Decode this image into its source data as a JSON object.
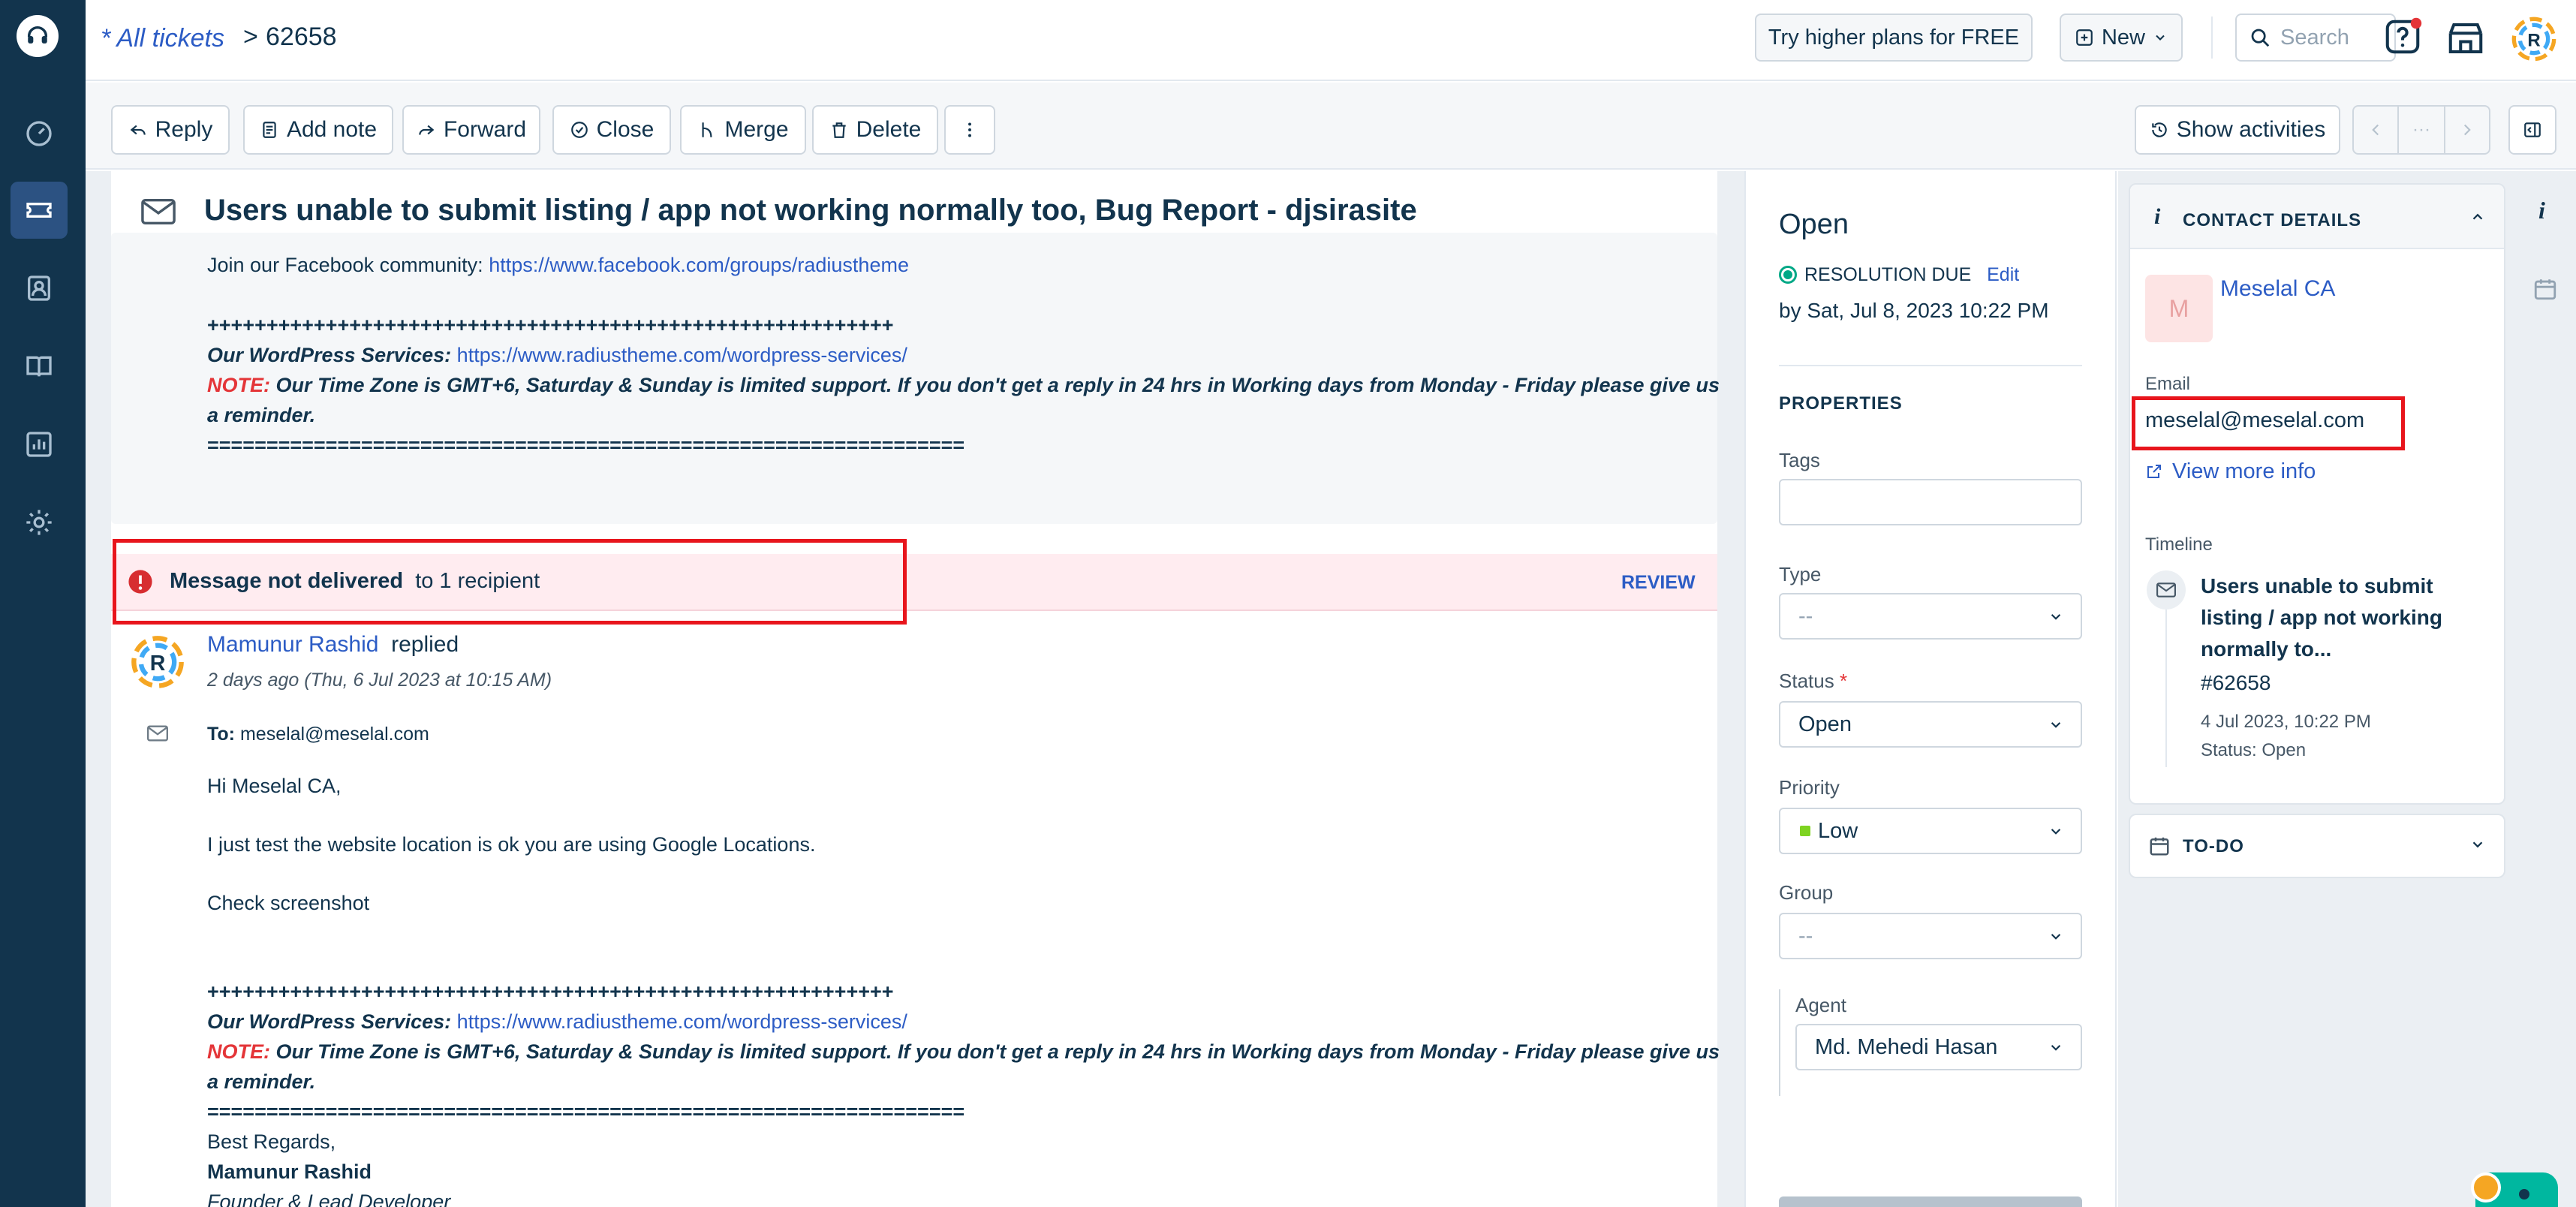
{
  "breadcrumb": {
    "all_tickets": "* All tickets",
    "separator": ">",
    "ticket_id": "62658"
  },
  "topbar": {
    "upgrade": "Try higher plans for FREE",
    "new": "New",
    "search_placeholder": "Search"
  },
  "actions": {
    "reply": "Reply",
    "add_note": "Add note",
    "forward": "Forward",
    "close": "Close",
    "merge": "Merge",
    "delete": "Delete",
    "show_activities": "Show activities",
    "pager_dots": "···"
  },
  "ticket": {
    "subject": "Users unable to submit listing / app not working normally too, Bug Report - djsirasite",
    "first_message": {
      "community_text": "Join our Facebook community:",
      "community_link": "https://www.facebook.com/groups/radiustheme",
      "plus_line": "++++++++++++++++++++++++++++++++++++++++++++++++++++++++++",
      "services_label": "Our WordPress Services:",
      "services_link": "https://www.radiustheme.com/wordpress-services/",
      "note_label": "NOTE:",
      "note_text": "Our Time Zone is GMT+6, Saturday & Sunday is limited support. If you don't get a reply in 24 hrs in Working days from Monday - Friday please give us",
      "note_text_2": "a reminder.",
      "equals_line": "================================================================"
    },
    "banner": {
      "title": "Message not delivered",
      "detail": "to 1 recipient",
      "review": "REVIEW"
    },
    "reply": {
      "author": "Mamunur Rashid",
      "action": "replied",
      "time": "2 days ago (Thu, 6 Jul 2023 at 10:15 AM)",
      "to_label": "To:",
      "to_value": "meselal@meselal.com",
      "greeting": "Hi Meselal CA,",
      "line1": "I just test the website location is ok you are using Google Locations.",
      "line2": "Check screenshot",
      "plus_line": "++++++++++++++++++++++++++++++++++++++++++++++++++++++++++",
      "services_label": "Our WordPress Services:",
      "services_link": "https://www.radiustheme.com/wordpress-services/",
      "note_label": "NOTE:",
      "note_text": "Our Time Zone is GMT+6, Saturday & Sunday is limited support. If you don't get a reply in 24 hrs in Working days from Monday - Friday please give us",
      "note_text_2": "a reminder.",
      "equals_line": "================================================================",
      "regards": "Best Regards,",
      "sig_name": "Mamunur Rashid",
      "sig_title": "Founder & Lead Developer"
    }
  },
  "properties_panel": {
    "status_heading": "Open",
    "resolution_label": "RESOLUTION DUE",
    "edit": "Edit",
    "due": "by Sat, Jul 8, 2023 10:22 PM",
    "section": "PROPERTIES",
    "tags_label": "Tags",
    "type_label": "Type",
    "type_value": "--",
    "status_label": "Status",
    "required_mark": "*",
    "status_value": "Open",
    "priority_label": "Priority",
    "priority_value": "Low",
    "group_label": "Group",
    "group_value": "--",
    "agent_label": "Agent",
    "agent_value": "Md. Mehedi Hasan"
  },
  "contact": {
    "heading": "CONTACT DETAILS",
    "avatar_initial": "M",
    "name": "Meselal CA",
    "email_label": "Email",
    "email": "meselal@meselal.com",
    "view_more": "View more info",
    "timeline_label": "Timeline",
    "timeline_title_1": "Users unable to submit",
    "timeline_title_2": "listing / app not working",
    "timeline_title_3": "normally to...",
    "timeline_id": "#62658",
    "timeline_date": "4 Jul 2023, 10:22 PM",
    "timeline_status": "Status: Open"
  },
  "todo": {
    "heading": "TO-DO"
  },
  "colors": {
    "nav_bg": "#12344d",
    "link": "#2c5cc5",
    "highlight": "#e8151c",
    "banner_bg": "#ffecf0",
    "priority_low": "#7ed321"
  }
}
